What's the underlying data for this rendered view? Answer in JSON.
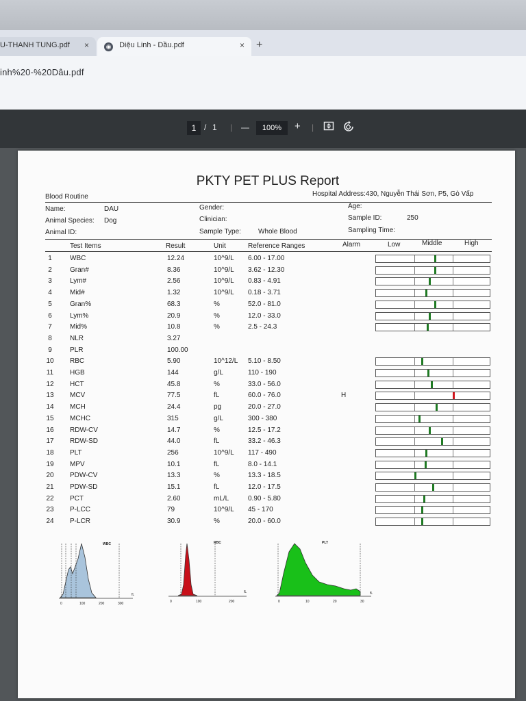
{
  "browser": {
    "tabs": [
      {
        "title": "U-THANH TUNG.pdf",
        "close": "×"
      },
      {
        "title": "Diệu Linh - Dầu.pdf",
        "close": "×"
      }
    ],
    "new_tab": "+",
    "url": "inh%20-%20Dâu.pdf"
  },
  "pdf_toolbar": {
    "page_current": "1",
    "page_sep": "/",
    "page_total": "1",
    "zoom_minus": "—",
    "zoom": "100%",
    "zoom_plus": "+",
    "fit_icon": "fit-page-icon",
    "rotate_icon": "rotate-icon"
  },
  "report": {
    "title": "PKTY PET PLUS Report",
    "section": "Blood Routine",
    "hospital": "Hospital Address:430, Nguyễn Thái Sơn, P5, Gò Vấp",
    "name_label": "Name:",
    "name_value": "DAU",
    "species_label": "Animal Species:",
    "species_value": "Dog",
    "animal_id_label": "Animal ID:",
    "gender_label": "Gender:",
    "clinician_label": "Clinician:",
    "sample_type_label": "Sample Type:",
    "sample_type_value": "Whole Blood",
    "age_label": "Age:",
    "sample_id_label": "Sample ID:",
    "sample_id_value": "250",
    "sampling_time_label": "Sampling Time:",
    "headers": {
      "items": "Test Items",
      "result": "Result",
      "unit": "Unit",
      "ref": "Reference Ranges",
      "alarm": "Alarm",
      "low": "Low",
      "middle": "Middle",
      "high": "High"
    },
    "rows": [
      {
        "no": "1",
        "name": "WBC",
        "result": "12.24",
        "unit": "10^9/L",
        "ref": "6.00 - 17.00",
        "alarm": "",
        "level": 0.52
      },
      {
        "no": "2",
        "name": "Gran#",
        "result": "8.36",
        "unit": "10^9/L",
        "ref": "3.62 - 12.30",
        "alarm": "",
        "level": 0.52
      },
      {
        "no": "3",
        "name": "Lym#",
        "result": "2.56",
        "unit": "10^9/L",
        "ref": "0.83 - 4.91",
        "alarm": "",
        "level": 0.47
      },
      {
        "no": "4",
        "name": "Mid#",
        "result": "1.32",
        "unit": "10^9/L",
        "ref": "0.18 - 3.71",
        "alarm": "",
        "level": 0.44
      },
      {
        "no": "5",
        "name": "Gran%",
        "result": "68.3",
        "unit": "%",
        "ref": "52.0 - 81.0",
        "alarm": "",
        "level": 0.52
      },
      {
        "no": "6",
        "name": "Lym%",
        "result": "20.9",
        "unit": "%",
        "ref": "12.0 - 33.0",
        "alarm": "",
        "level": 0.47
      },
      {
        "no": "7",
        "name": "Mid%",
        "result": "10.8",
        "unit": "%",
        "ref": "2.5 - 24.3",
        "alarm": "",
        "level": 0.45
      },
      {
        "no": "8",
        "name": "NLR",
        "result": "3.27",
        "unit": "",
        "ref": "",
        "alarm": "",
        "level": null
      },
      {
        "no": "9",
        "name": "PLR",
        "result": "100.00",
        "unit": "",
        "ref": "",
        "alarm": "",
        "level": null
      },
      {
        "no": "10",
        "name": "RBC",
        "result": "5.90",
        "unit": "10^12/L",
        "ref": "5.10 - 8.50",
        "alarm": "",
        "level": 0.4
      },
      {
        "no": "11",
        "name": "HGB",
        "result": "144",
        "unit": "g/L",
        "ref": "110 - 190",
        "alarm": "",
        "level": 0.46
      },
      {
        "no": "12",
        "name": "HCT",
        "result": "45.8",
        "unit": "%",
        "ref": "33.0 - 56.0",
        "alarm": "",
        "level": 0.49
      },
      {
        "no": "13",
        "name": "MCV",
        "result": "77.5",
        "unit": "fL",
        "ref": "60.0 - 76.0",
        "alarm": "H",
        "level": 0.68
      },
      {
        "no": "14",
        "name": "MCH",
        "result": "24.4",
        "unit": "pg",
        "ref": "20.0 - 27.0",
        "alarm": "",
        "level": 0.53
      },
      {
        "no": "15",
        "name": "MCHC",
        "result": "315",
        "unit": "g/L",
        "ref": "300 - 380",
        "alarm": "",
        "level": 0.38
      },
      {
        "no": "16",
        "name": "RDW-CV",
        "result": "14.7",
        "unit": "%",
        "ref": "12.5 - 17.2",
        "alarm": "",
        "level": 0.47
      },
      {
        "no": "17",
        "name": "RDW-SD",
        "result": "44.0",
        "unit": "fL",
        "ref": "33.2 - 46.3",
        "alarm": "",
        "level": 0.58
      },
      {
        "no": "18",
        "name": "PLT",
        "result": "256",
        "unit": "10^9/L",
        "ref": "117 - 490",
        "alarm": "",
        "level": 0.44
      },
      {
        "no": "19",
        "name": "MPV",
        "result": "10.1",
        "unit": "fL",
        "ref": "8.0 - 14.1",
        "alarm": "",
        "level": 0.43
      },
      {
        "no": "20",
        "name": "PDW-CV",
        "result": "13.3",
        "unit": "%",
        "ref": "13.3 - 18.5",
        "alarm": "",
        "level": 0.34
      },
      {
        "no": "21",
        "name": "PDW-SD",
        "result": "15.1",
        "unit": "fL",
        "ref": "12.0 - 17.5",
        "alarm": "",
        "level": 0.5
      },
      {
        "no": "22",
        "name": "PCT",
        "result": "2.60",
        "unit": "mL/L",
        "ref": "0.90 - 5.80",
        "alarm": "",
        "level": 0.42
      },
      {
        "no": "23",
        "name": "P-LCC",
        "result": "79",
        "unit": "10^9/L",
        "ref": "45 - 170",
        "alarm": "",
        "level": 0.4
      },
      {
        "no": "24",
        "name": "P-LCR",
        "result": "30.9",
        "unit": "%",
        "ref": "20.0 - 60.0",
        "alarm": "",
        "level": 0.4
      }
    ]
  },
  "histograms": [
    {
      "title": "WBC",
      "color": "#a9c4dc",
      "ticks": [
        "0",
        "100",
        "200",
        "300"
      ],
      "unit": "fL"
    },
    {
      "title": "RBC",
      "color": "#c8101a",
      "ticks": [
        "0",
        "100",
        "200"
      ],
      "unit": "fL"
    },
    {
      "title": "PLT",
      "color": "#19c019",
      "ticks": [
        "0",
        "10",
        "20",
        "30"
      ],
      "unit": "fL"
    }
  ],
  "colors": {
    "normal_marker": "#1f7a23",
    "high_marker": "#d0141c"
  }
}
